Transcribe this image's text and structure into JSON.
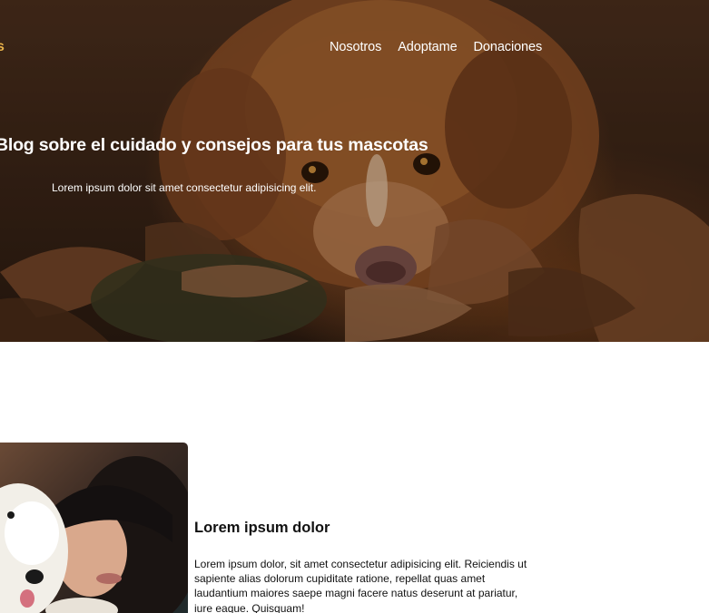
{
  "brand": {
    "glyph": "s"
  },
  "nav": {
    "items": [
      "Nosotros",
      "Adoptame",
      "Donaciones"
    ]
  },
  "hero": {
    "title": "Blog sobre el cuidado y consejos para tus mascotas",
    "subtitle": "Lorem ipsum dolor sit amet consectetur adipisicing elit."
  },
  "feature": {
    "title": "Lorem ipsum dolor",
    "text": "Lorem ipsum dolor, sit amet consectetur adipisicing elit. Reiciendis ut sapiente alias dolorum cupiditate ratione, repellat quas amet laudantium maiores saepe magni facere natus deserunt at pariatur, iure eaque. Quisquam!"
  },
  "colors": {
    "accent": "#e8b24a",
    "hero_text": "#ffffff",
    "body_text": "#111111"
  }
}
